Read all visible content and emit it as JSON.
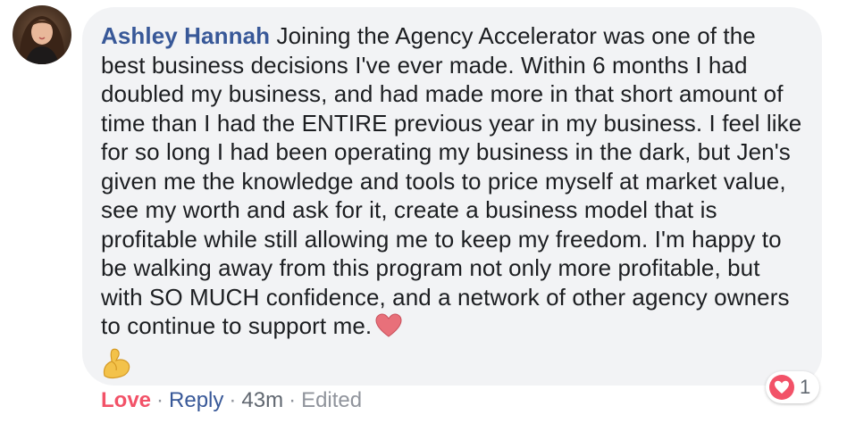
{
  "comment": {
    "author": "Ashley Hannah",
    "body": "Joining the Agency Accelerator was one of the best business decisions I've ever made. Within 6 months I had doubled my business, and had made more in that short amount of time than I had the ENTIRE previous year in my business. I feel like for so long I had been operating my business in the dark, but Jen's given me the knowledge and tools to price myself at market value, see my worth and ask for it, create a business model that is profitable while still allowing me to keep my freedom. I'm happy to be walking away from this program not only more profitable, but with SO MUCH confidence, and a network of other agency owners to continue to support me.",
    "emojis": [
      "heart-emoji",
      "flexed-biceps-emoji"
    ]
  },
  "reactions": {
    "icon": "heart-icon",
    "count": "1",
    "color": "#f25268"
  },
  "actions": {
    "love": "Love",
    "reply": "Reply",
    "separator": "·",
    "time": "43m",
    "edited": "Edited"
  },
  "colors": {
    "author": "#385898",
    "bubble": "#f2f3f5",
    "love": "#f25268"
  }
}
